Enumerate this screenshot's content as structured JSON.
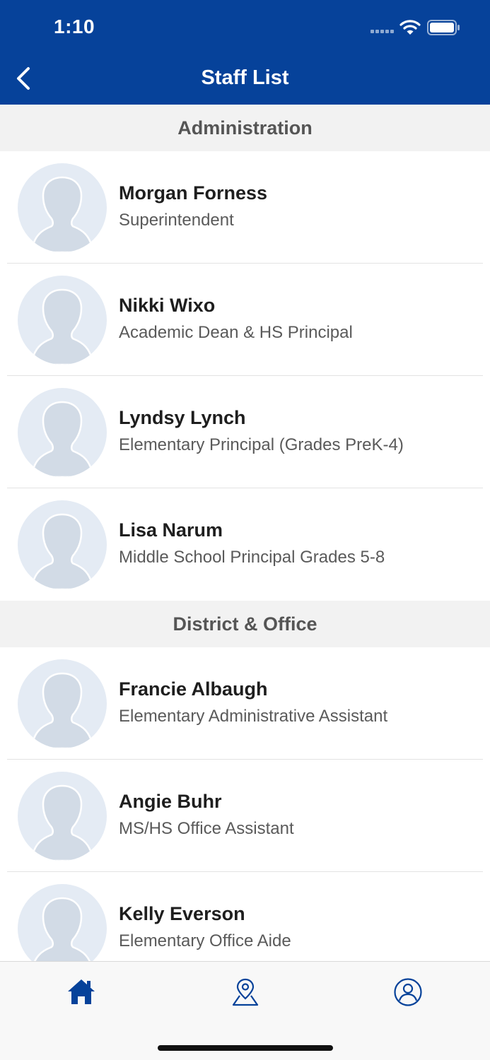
{
  "status_bar": {
    "time": "1:10"
  },
  "nav": {
    "title": "Staff List"
  },
  "colors": {
    "brand": "#06429a",
    "section_bg": "#f2f2f2",
    "avatar_bg": "#e4ebf4"
  },
  "sections": [
    {
      "title": "Administration",
      "staff": [
        {
          "name": "Morgan Forness",
          "title": "Superintendent"
        },
        {
          "name": "Nikki Wixo",
          "title": "Academic Dean & HS Principal"
        },
        {
          "name": "Lyndsy Lynch",
          "title": "Elementary Principal (Grades PreK-4)"
        },
        {
          "name": "Lisa Narum",
          "title": "Middle School Principal Grades 5-8"
        }
      ]
    },
    {
      "title": "District & Office",
      "staff": [
        {
          "name": "Francie Albaugh",
          "title": "Elementary Administrative Assistant"
        },
        {
          "name": "Angie Buhr",
          "title": "MS/HS Office Assistant"
        },
        {
          "name": "Kelly Everson",
          "title": "Elementary Office Aide"
        }
      ]
    }
  ],
  "tabs": [
    {
      "icon": "home-icon",
      "active": true
    },
    {
      "icon": "map-pin-icon",
      "active": false
    },
    {
      "icon": "user-profile-icon",
      "active": false
    }
  ]
}
